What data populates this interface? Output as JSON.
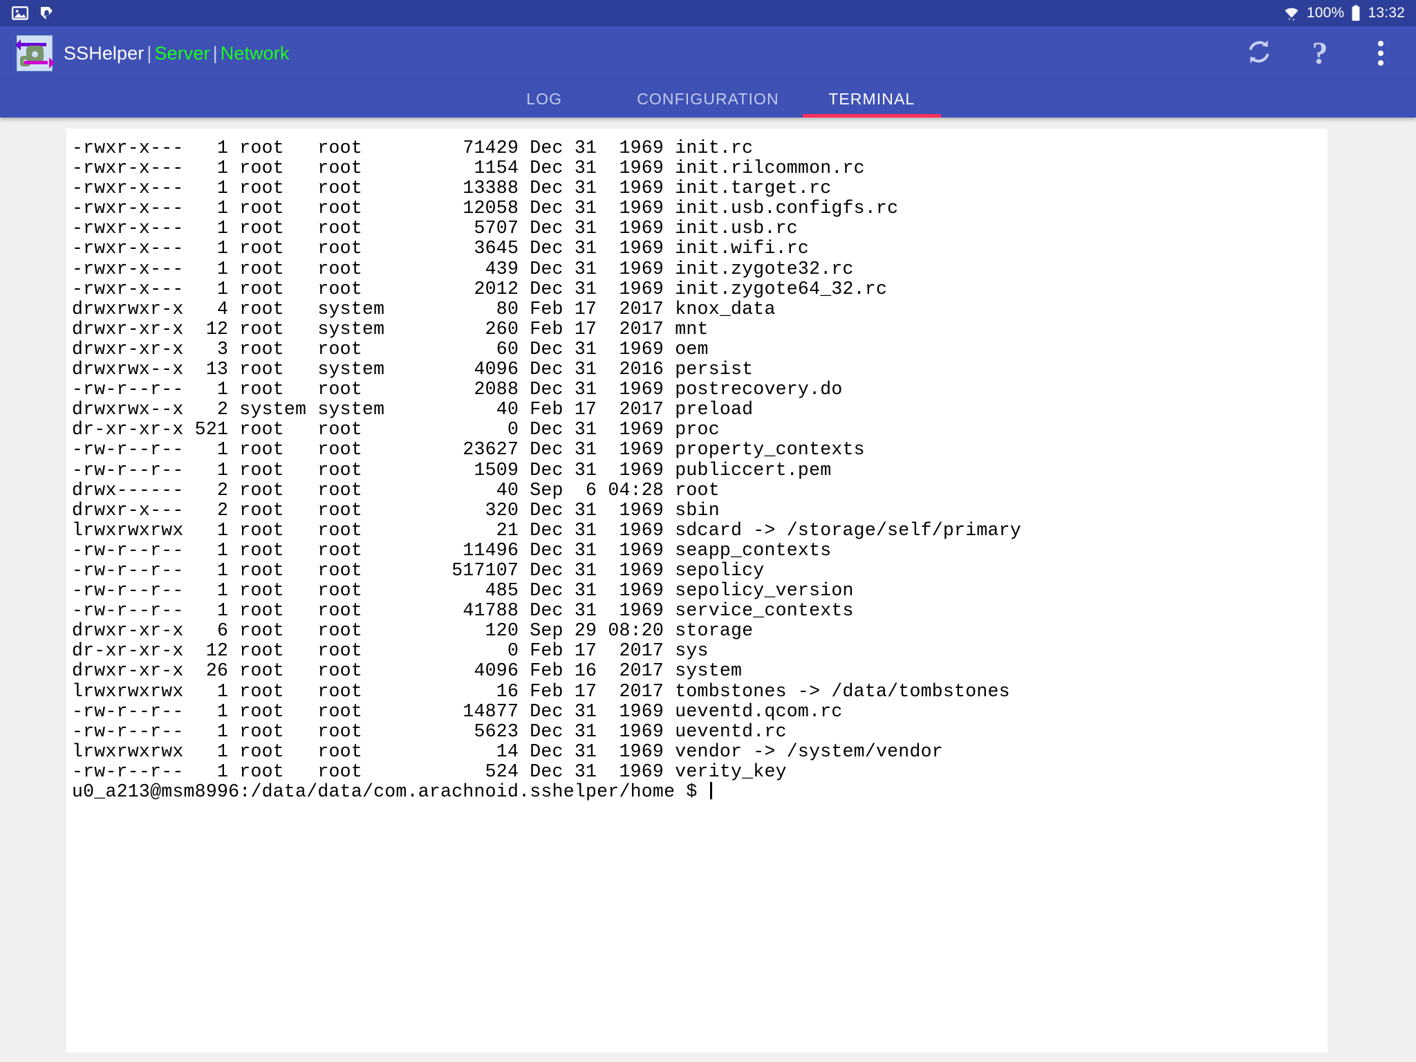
{
  "status_bar": {
    "left_icons": [
      "image-icon",
      "notification-bell-icon"
    ],
    "wifi_icon": "wifi-icon",
    "battery_percent": "100%",
    "battery_icon": "battery-full-icon",
    "clock": "13:32"
  },
  "app_bar": {
    "logo": "sshelper-logo-icon",
    "title_app": "SSHelper",
    "sep1": "|",
    "title_server": "Server",
    "sep2": "|",
    "title_network": "Network",
    "actions": [
      {
        "name": "refresh-button",
        "icon": "sync-refresh-icon",
        "label": ""
      },
      {
        "name": "help-button",
        "icon": "question-mark-icon",
        "label": "?"
      },
      {
        "name": "overflow-menu-button",
        "icon": "kebab-menu-icon",
        "label": ""
      }
    ]
  },
  "tabs": [
    {
      "label": "LOG",
      "active": false
    },
    {
      "label": "CONFIGURATION",
      "active": false
    },
    {
      "label": "TERMINAL",
      "active": true
    }
  ],
  "colors": {
    "status_bar_bg": "#2e3f99",
    "app_bar_bg": "#3f51b5",
    "tab_indicator": "#ff2d5e",
    "tab_active_text": "#ffffff",
    "tab_inactive_text": "#c3cbee",
    "brand_green": "#1aff1a",
    "terminal_bg": "#ffffff",
    "terminal_text": "#000000",
    "page_bg": "#f0f0f0"
  },
  "terminal": {
    "columns": [
      "permissions",
      "links",
      "owner",
      "group",
      "size",
      "month",
      "day",
      "year_or_time",
      "name"
    ],
    "rows": [
      {
        "permissions": "-rwxr-x---",
        "links": "1",
        "owner": "root",
        "group": "root",
        "size": "71429",
        "month": "Dec",
        "day": "31",
        "year_or_time": "1969",
        "name": "init.rc"
      },
      {
        "permissions": "-rwxr-x---",
        "links": "1",
        "owner": "root",
        "group": "root",
        "size": "1154",
        "month": "Dec",
        "day": "31",
        "year_or_time": "1969",
        "name": "init.rilcommon.rc"
      },
      {
        "permissions": "-rwxr-x---",
        "links": "1",
        "owner": "root",
        "group": "root",
        "size": "13388",
        "month": "Dec",
        "day": "31",
        "year_or_time": "1969",
        "name": "init.target.rc"
      },
      {
        "permissions": "-rwxr-x---",
        "links": "1",
        "owner": "root",
        "group": "root",
        "size": "12058",
        "month": "Dec",
        "day": "31",
        "year_or_time": "1969",
        "name": "init.usb.configfs.rc"
      },
      {
        "permissions": "-rwxr-x---",
        "links": "1",
        "owner": "root",
        "group": "root",
        "size": "5707",
        "month": "Dec",
        "day": "31",
        "year_or_time": "1969",
        "name": "init.usb.rc"
      },
      {
        "permissions": "-rwxr-x---",
        "links": "1",
        "owner": "root",
        "group": "root",
        "size": "3645",
        "month": "Dec",
        "day": "31",
        "year_or_time": "1969",
        "name": "init.wifi.rc"
      },
      {
        "permissions": "-rwxr-x---",
        "links": "1",
        "owner": "root",
        "group": "root",
        "size": "439",
        "month": "Dec",
        "day": "31",
        "year_or_time": "1969",
        "name": "init.zygote32.rc"
      },
      {
        "permissions": "-rwxr-x---",
        "links": "1",
        "owner": "root",
        "group": "root",
        "size": "2012",
        "month": "Dec",
        "day": "31",
        "year_or_time": "1969",
        "name": "init.zygote64_32.rc"
      },
      {
        "permissions": "drwxrwxr-x",
        "links": "4",
        "owner": "root",
        "group": "system",
        "size": "80",
        "month": "Feb",
        "day": "17",
        "year_or_time": "2017",
        "name": "knox_data"
      },
      {
        "permissions": "drwxr-xr-x",
        "links": "12",
        "owner": "root",
        "group": "system",
        "size": "260",
        "month": "Feb",
        "day": "17",
        "year_or_time": "2017",
        "name": "mnt"
      },
      {
        "permissions": "drwxr-xr-x",
        "links": "3",
        "owner": "root",
        "group": "root",
        "size": "60",
        "month": "Dec",
        "day": "31",
        "year_or_time": "1969",
        "name": "oem"
      },
      {
        "permissions": "drwxrwx--x",
        "links": "13",
        "owner": "root",
        "group": "system",
        "size": "4096",
        "month": "Dec",
        "day": "31",
        "year_or_time": "2016",
        "name": "persist"
      },
      {
        "permissions": "-rw-r--r--",
        "links": "1",
        "owner": "root",
        "group": "root",
        "size": "2088",
        "month": "Dec",
        "day": "31",
        "year_or_time": "1969",
        "name": "postrecovery.do"
      },
      {
        "permissions": "drwxrwx--x",
        "links": "2",
        "owner": "system",
        "group": "system",
        "size": "40",
        "month": "Feb",
        "day": "17",
        "year_or_time": "2017",
        "name": "preload"
      },
      {
        "permissions": "dr-xr-xr-x",
        "links": "521",
        "owner": "root",
        "group": "root",
        "size": "0",
        "month": "Dec",
        "day": "31",
        "year_or_time": "1969",
        "name": "proc"
      },
      {
        "permissions": "-rw-r--r--",
        "links": "1",
        "owner": "root",
        "group": "root",
        "size": "23627",
        "month": "Dec",
        "day": "31",
        "year_or_time": "1969",
        "name": "property_contexts"
      },
      {
        "permissions": "-rw-r--r--",
        "links": "1",
        "owner": "root",
        "group": "root",
        "size": "1509",
        "month": "Dec",
        "day": "31",
        "year_or_time": "1969",
        "name": "publiccert.pem"
      },
      {
        "permissions": "drwx------",
        "links": "2",
        "owner": "root",
        "group": "root",
        "size": "40",
        "month": "Sep",
        "day": "6",
        "year_or_time": "04:28",
        "name": "root"
      },
      {
        "permissions": "drwxr-x---",
        "links": "2",
        "owner": "root",
        "group": "root",
        "size": "320",
        "month": "Dec",
        "day": "31",
        "year_or_time": "1969",
        "name": "sbin"
      },
      {
        "permissions": "lrwxrwxrwx",
        "links": "1",
        "owner": "root",
        "group": "root",
        "size": "21",
        "month": "Dec",
        "day": "31",
        "year_or_time": "1969",
        "name": "sdcard -> /storage/self/primary"
      },
      {
        "permissions": "-rw-r--r--",
        "links": "1",
        "owner": "root",
        "group": "root",
        "size": "11496",
        "month": "Dec",
        "day": "31",
        "year_or_time": "1969",
        "name": "seapp_contexts"
      },
      {
        "permissions": "-rw-r--r--",
        "links": "1",
        "owner": "root",
        "group": "root",
        "size": "517107",
        "month": "Dec",
        "day": "31",
        "year_or_time": "1969",
        "name": "sepolicy"
      },
      {
        "permissions": "-rw-r--r--",
        "links": "1",
        "owner": "root",
        "group": "root",
        "size": "485",
        "month": "Dec",
        "day": "31",
        "year_or_time": "1969",
        "name": "sepolicy_version"
      },
      {
        "permissions": "-rw-r--r--",
        "links": "1",
        "owner": "root",
        "group": "root",
        "size": "41788",
        "month": "Dec",
        "day": "31",
        "year_or_time": "1969",
        "name": "service_contexts"
      },
      {
        "permissions": "drwxr-xr-x",
        "links": "6",
        "owner": "root",
        "group": "root",
        "size": "120",
        "month": "Sep",
        "day": "29",
        "year_or_time": "08:20",
        "name": "storage"
      },
      {
        "permissions": "dr-xr-xr-x",
        "links": "12",
        "owner": "root",
        "group": "root",
        "size": "0",
        "month": "Feb",
        "day": "17",
        "year_or_time": "2017",
        "name": "sys"
      },
      {
        "permissions": "drwxr-xr-x",
        "links": "26",
        "owner": "root",
        "group": "root",
        "size": "4096",
        "month": "Feb",
        "day": "16",
        "year_or_time": "2017",
        "name": "system"
      },
      {
        "permissions": "lrwxrwxrwx",
        "links": "1",
        "owner": "root",
        "group": "root",
        "size": "16",
        "month": "Feb",
        "day": "17",
        "year_or_time": "2017",
        "name": "tombstones -> /data/tombstones"
      },
      {
        "permissions": "-rw-r--r--",
        "links": "1",
        "owner": "root",
        "group": "root",
        "size": "14877",
        "month": "Dec",
        "day": "31",
        "year_or_time": "1969",
        "name": "ueventd.qcom.rc"
      },
      {
        "permissions": "-rw-r--r--",
        "links": "1",
        "owner": "root",
        "group": "root",
        "size": "5623",
        "month": "Dec",
        "day": "31",
        "year_or_time": "1969",
        "name": "ueventd.rc"
      },
      {
        "permissions": "lrwxrwxrwx",
        "links": "1",
        "owner": "root",
        "group": "root",
        "size": "14",
        "month": "Dec",
        "day": "31",
        "year_or_time": "1969",
        "name": "vendor -> /system/vendor"
      },
      {
        "permissions": "-rw-r--r--",
        "links": "1",
        "owner": "root",
        "group": "root",
        "size": "524",
        "month": "Dec",
        "day": "31",
        "year_or_time": "1969",
        "name": "verity_key"
      }
    ],
    "prompt": "u0_a213@msm8996:/data/data/com.arachnoid.sshelper/home $ "
  }
}
